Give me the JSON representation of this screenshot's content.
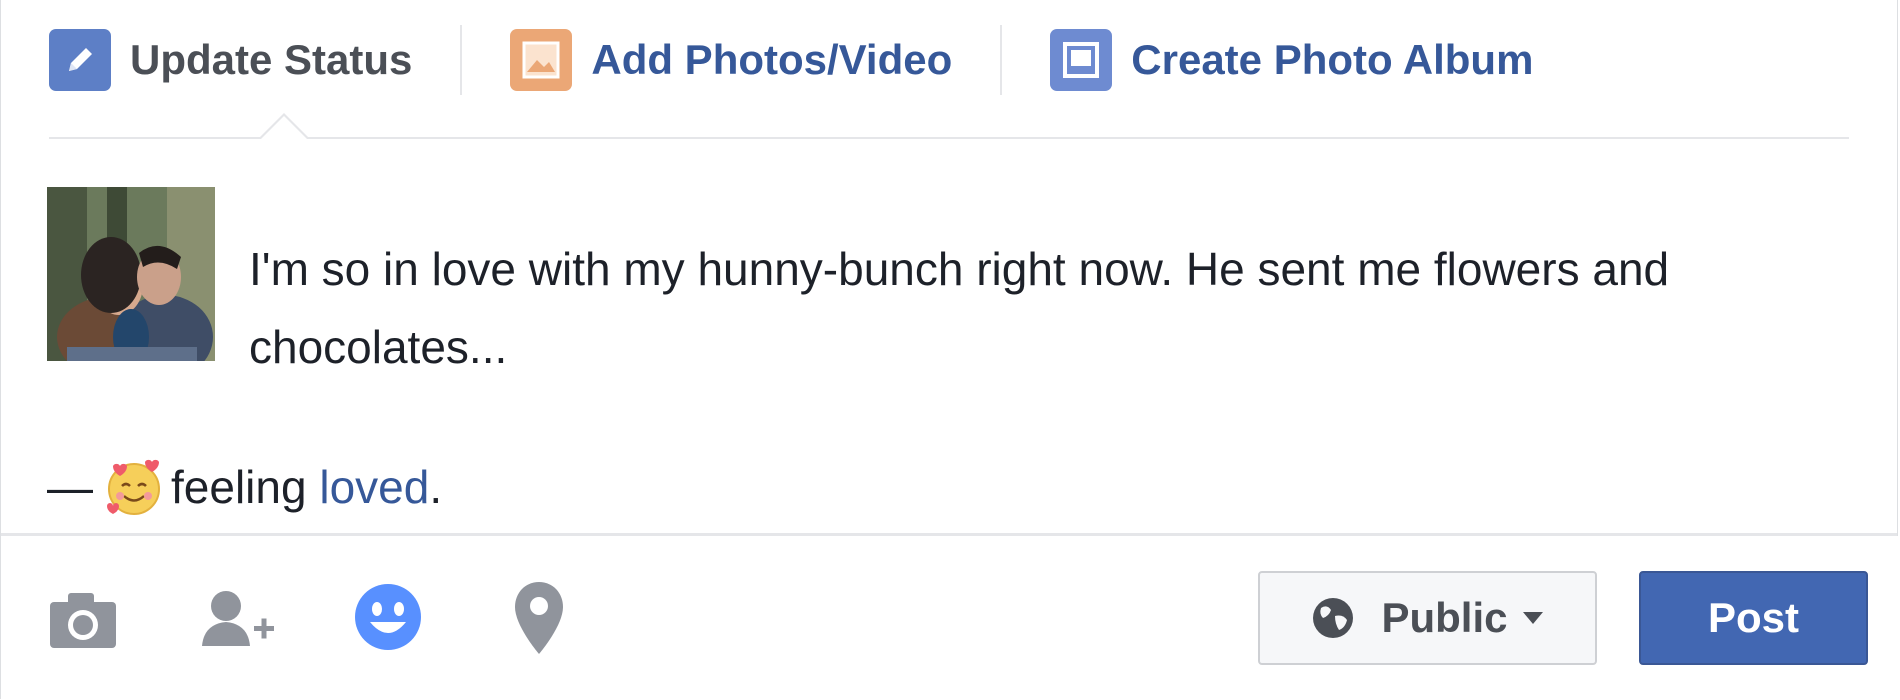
{
  "tabs": {
    "update_status": "Update Status",
    "add_photos": "Add Photos/Video",
    "create_album": "Create Photo Album"
  },
  "post": {
    "text": "I'm so in love with my hunny-bunch right now. He sent me flowers and chocolates...",
    "feeling_prefix": "—",
    "feeling_text": "feeling",
    "feeling_value": "loved",
    "feeling_suffix": "."
  },
  "footer": {
    "icons": [
      "camera-icon",
      "tag-friends-icon",
      "feeling-icon",
      "location-pin-icon"
    ],
    "audience": "Public",
    "post_button": "Post"
  },
  "colors": {
    "link_blue": "#365899",
    "button_blue": "#4267b2",
    "feeling_active": "#5890ff",
    "icon_gray": "#90949c"
  }
}
